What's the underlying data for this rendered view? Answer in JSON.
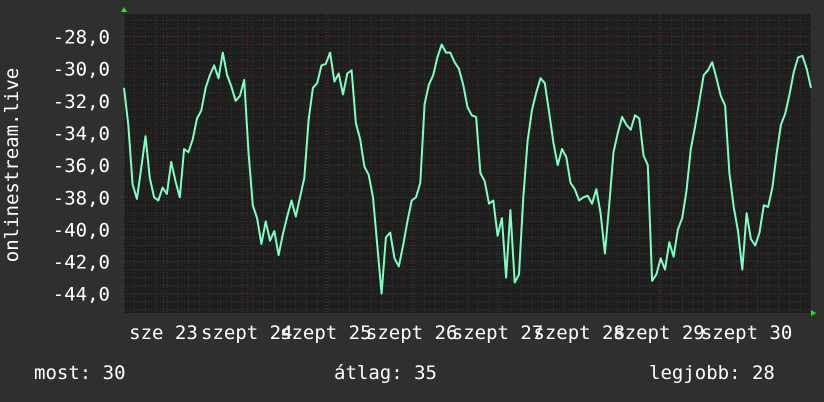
{
  "chart_data": {
    "type": "line",
    "ylabel": "onlinestream.live",
    "title": "",
    "xlabel": "",
    "ylim": [
      -45.2,
      -26.6
    ],
    "y_ticks": [
      -28,
      -30,
      -32,
      -34,
      -36,
      -38,
      -40,
      -42,
      -44
    ],
    "y_tick_labels": [
      "-28,0",
      "-30,0",
      "-32,0",
      "-34,0",
      "-36,0",
      "-38,0",
      "-40,0",
      "-42,0",
      "-44,0"
    ],
    "x_range": [
      0,
      8
    ],
    "x_tick_positions": [
      0.46,
      1.43,
      2.35,
      3.35,
      4.35,
      5.3,
      6.23,
      7.25
    ],
    "x_tick_labels": [
      "sze 23",
      "szept 24",
      "szept 25",
      "szept 26",
      "szept 27",
      "szept 28",
      "szept 29",
      "szept 30"
    ],
    "grid": true,
    "series": [
      {
        "color": "#7fffc0",
        "x": [
          0.0,
          0.05,
          0.1,
          0.15,
          0.2,
          0.25,
          0.3,
          0.35,
          0.4,
          0.45,
          0.5,
          0.55,
          0.6,
          0.65,
          0.7,
          0.75,
          0.8,
          0.85,
          0.9,
          0.95,
          1.0,
          1.05,
          1.1,
          1.15,
          1.2,
          1.25,
          1.3,
          1.35,
          1.4,
          1.45,
          1.5,
          1.55,
          1.6,
          1.65,
          1.7,
          1.75,
          1.8,
          1.85,
          1.9,
          1.95,
          2.0,
          2.05,
          2.1,
          2.15,
          2.2,
          2.25,
          2.3,
          2.35,
          2.4,
          2.45,
          2.5,
          2.55,
          2.6,
          2.65,
          2.7,
          2.75,
          2.8,
          2.85,
          2.9,
          2.95,
          3.0,
          3.05,
          3.1,
          3.15,
          3.2,
          3.25,
          3.3,
          3.35,
          3.4,
          3.45,
          3.5,
          3.55,
          3.6,
          3.65,
          3.7,
          3.75,
          3.8,
          3.85,
          3.9,
          3.95,
          4.0,
          4.05,
          4.1,
          4.15,
          4.2,
          4.25,
          4.3,
          4.35,
          4.4,
          4.45,
          4.5,
          4.55,
          4.6,
          4.65,
          4.7,
          4.75,
          4.8,
          4.85,
          4.9,
          4.95,
          5.0,
          5.05,
          5.1,
          5.15,
          5.2,
          5.25,
          5.3,
          5.35,
          5.4,
          5.45,
          5.5,
          5.55,
          5.6,
          5.65,
          5.7,
          5.75,
          5.8,
          5.85,
          5.9,
          5.95,
          6.0,
          6.05,
          6.1,
          6.15,
          6.2,
          6.25,
          6.3,
          6.35,
          6.4,
          6.45,
          6.5,
          6.55,
          6.6,
          6.65,
          6.7,
          6.75,
          6.8,
          6.85,
          6.9,
          6.95,
          7.0,
          7.05,
          7.1,
          7.15,
          7.2,
          7.25,
          7.3,
          7.35,
          7.4,
          7.45,
          7.5,
          7.55,
          7.6,
          7.65,
          7.7,
          7.75,
          7.8,
          7.85,
          7.9,
          7.95,
          8.0
        ],
        "values": [
          -31.2,
          -33.5,
          -37.2,
          -38.1,
          -36.2,
          -34.2,
          -36.8,
          -38.0,
          -38.2,
          -37.4,
          -37.8,
          -35.8,
          -37.0,
          -38.0,
          -35.0,
          -35.2,
          -34.4,
          -33.1,
          -32.6,
          -31.2,
          -30.4,
          -29.8,
          -30.6,
          -29.0,
          -30.4,
          -31.1,
          -32.0,
          -31.7,
          -30.7,
          -35.2,
          -38.5,
          -39.3,
          -40.9,
          -39.5,
          -40.7,
          -40.1,
          -41.6,
          -40.3,
          -39.2,
          -38.2,
          -39.2,
          -38.0,
          -36.8,
          -33.2,
          -31.2,
          -30.9,
          -29.8,
          -29.7,
          -29.0,
          -30.8,
          -30.3,
          -31.6,
          -30.3,
          -30.1,
          -33.4,
          -34.4,
          -36.1,
          -36.6,
          -38.0,
          -41.0,
          -44.0,
          -40.5,
          -40.2,
          -41.8,
          -42.3,
          -41.0,
          -39.5,
          -38.2,
          -38.0,
          -37.1,
          -32.2,
          -31.0,
          -30.4,
          -29.3,
          -28.5,
          -29.0,
          -29.0,
          -29.6,
          -30.0,
          -31.0,
          -32.4,
          -32.9,
          -33.0,
          -36.5,
          -37.0,
          -38.4,
          -38.2,
          -40.4,
          -39.3,
          -43.0,
          -38.8,
          -43.3,
          -42.8,
          -38.0,
          -34.5,
          -32.6,
          -31.5,
          -30.6,
          -30.9,
          -32.7,
          -34.6,
          -36.0,
          -35.0,
          -35.5,
          -37.1,
          -37.5,
          -38.2,
          -38.0,
          -37.9,
          -38.4,
          -37.5,
          -39.0,
          -41.5,
          -38.5,
          -35.2,
          -34.0,
          -33.0,
          -33.5,
          -33.8,
          -32.9,
          -33.1,
          -35.4,
          -36.0,
          -43.2,
          -42.8,
          -41.8,
          -42.5,
          -40.8,
          -41.7,
          -40.0,
          -39.3,
          -37.6,
          -35.0,
          -33.6,
          -32.0,
          -30.4,
          -30.1,
          -29.6,
          -30.6,
          -31.7,
          -32.3,
          -36.5,
          -38.6,
          -40.1,
          -42.5,
          -39.0,
          -40.6,
          -41.0,
          -40.2,
          -38.5,
          -38.6,
          -37.4,
          -35.3,
          -33.5,
          -32.8,
          -31.6,
          -30.2,
          -29.3,
          -29.2,
          -30.0,
          -31.2
        ]
      }
    ]
  },
  "footer": {
    "now_label": "most: 30",
    "avg_label": "átlag: 35",
    "best_label": "legjobb: 28"
  },
  "colors": {
    "background": "#2f2f2f",
    "plot_background": "#1e1e1e",
    "grid_major": "#6a2a2a",
    "grid_minor": "#3a3a3a",
    "line": "#7fffc0",
    "axis_arrow": "#00ff00"
  }
}
